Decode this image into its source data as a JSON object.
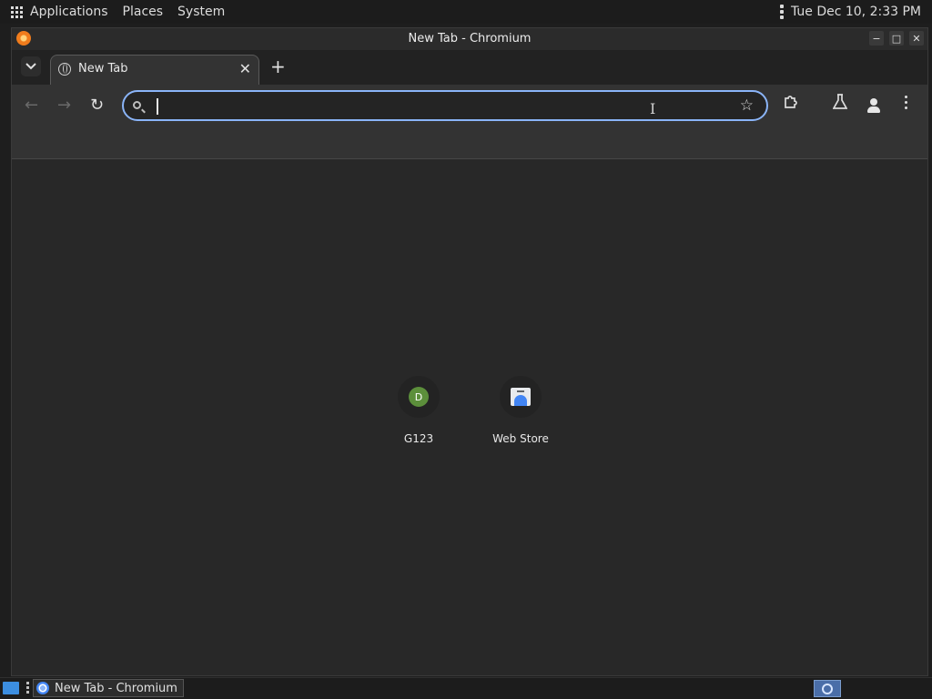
{
  "top_panel": {
    "menu": [
      "Applications",
      "Places",
      "System"
    ],
    "clock": "Tue Dec 10,  2:33 PM"
  },
  "window": {
    "title": "New Tab - Chromium"
  },
  "tabs": [
    {
      "title": "New Tab",
      "icon": "globe-icon",
      "active": true
    }
  ],
  "toolbar": {
    "omnibox_value": "",
    "icons": [
      "back-icon",
      "forward-icon",
      "reload-icon",
      "search-icon",
      "star-icon",
      "extensions-icon",
      "labs-icon",
      "profile-icon",
      "menu-icon"
    ]
  },
  "shortcuts": [
    {
      "label": "G123",
      "letter": "D",
      "icon_color": "#5c8f3b"
    },
    {
      "label": "Web Store",
      "icon": "web-store-icon"
    }
  ],
  "taskbar": {
    "tasks": [
      {
        "label": "New Tab - Chromium"
      }
    ]
  },
  "colors": {
    "accent": "#8ab4f8",
    "background": "#282828"
  }
}
